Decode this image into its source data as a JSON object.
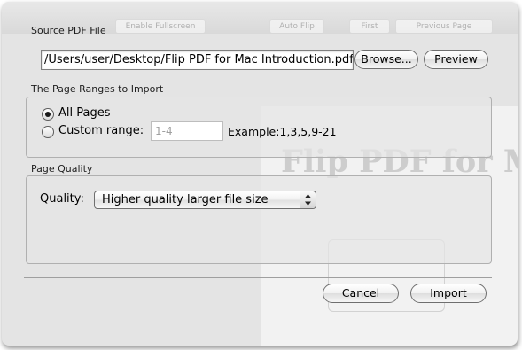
{
  "source_pdf": {
    "section_label": "Source PDF File",
    "path_value": "/Users/user/Desktop/Flip PDF for Mac Introduction.pdf",
    "browse_label": "Browse...",
    "preview_label": "Preview"
  },
  "page_ranges": {
    "section_label": "The Page Ranges to Import",
    "all_pages_label": "All Pages",
    "all_pages_selected": true,
    "custom_range_label": "Custom range:",
    "custom_range_placeholder": "1-4",
    "example_text": "Example:1,3,5,9-21"
  },
  "page_quality": {
    "section_label": "Page Quality",
    "quality_label": "Quality:",
    "quality_selected": "Higher quality larger file size"
  },
  "footer": {
    "cancel_label": "Cancel",
    "import_label": "Import"
  },
  "background": {
    "toolbar_items": [
      "Enable Fullscreen",
      "Auto Flip",
      "First",
      "Previous Page"
    ],
    "page_title": "Flip PDF for Ma"
  }
}
